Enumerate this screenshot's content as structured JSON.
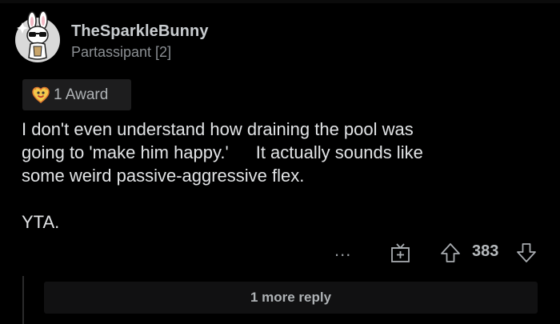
{
  "comment": {
    "author": {
      "username": "TheSparkleBunny",
      "flair": "Partassipant [2]"
    },
    "award": {
      "icon": "wholesome-heart-award-icon",
      "label": "1 Award"
    },
    "body": {
      "line1": "I don't even understand how draining the pool was",
      "line2a": "going to 'make him happy.'",
      "line2b": "It actually sounds like",
      "line3": "some weird passive-aggressive flex.",
      "paragraph2": "YTA."
    },
    "actions": {
      "more_label": "...",
      "gift_icon": "gift-icon",
      "upvote_icon": "upvote-arrow-icon",
      "score": "383",
      "downvote_icon": "downvote-arrow-icon"
    },
    "replies": {
      "more_label": "1 more reply"
    }
  },
  "colors": {
    "background": "#000000",
    "text": "#e2e4e6",
    "muted": "#8b8f93",
    "chip": "#1d1d1e"
  }
}
